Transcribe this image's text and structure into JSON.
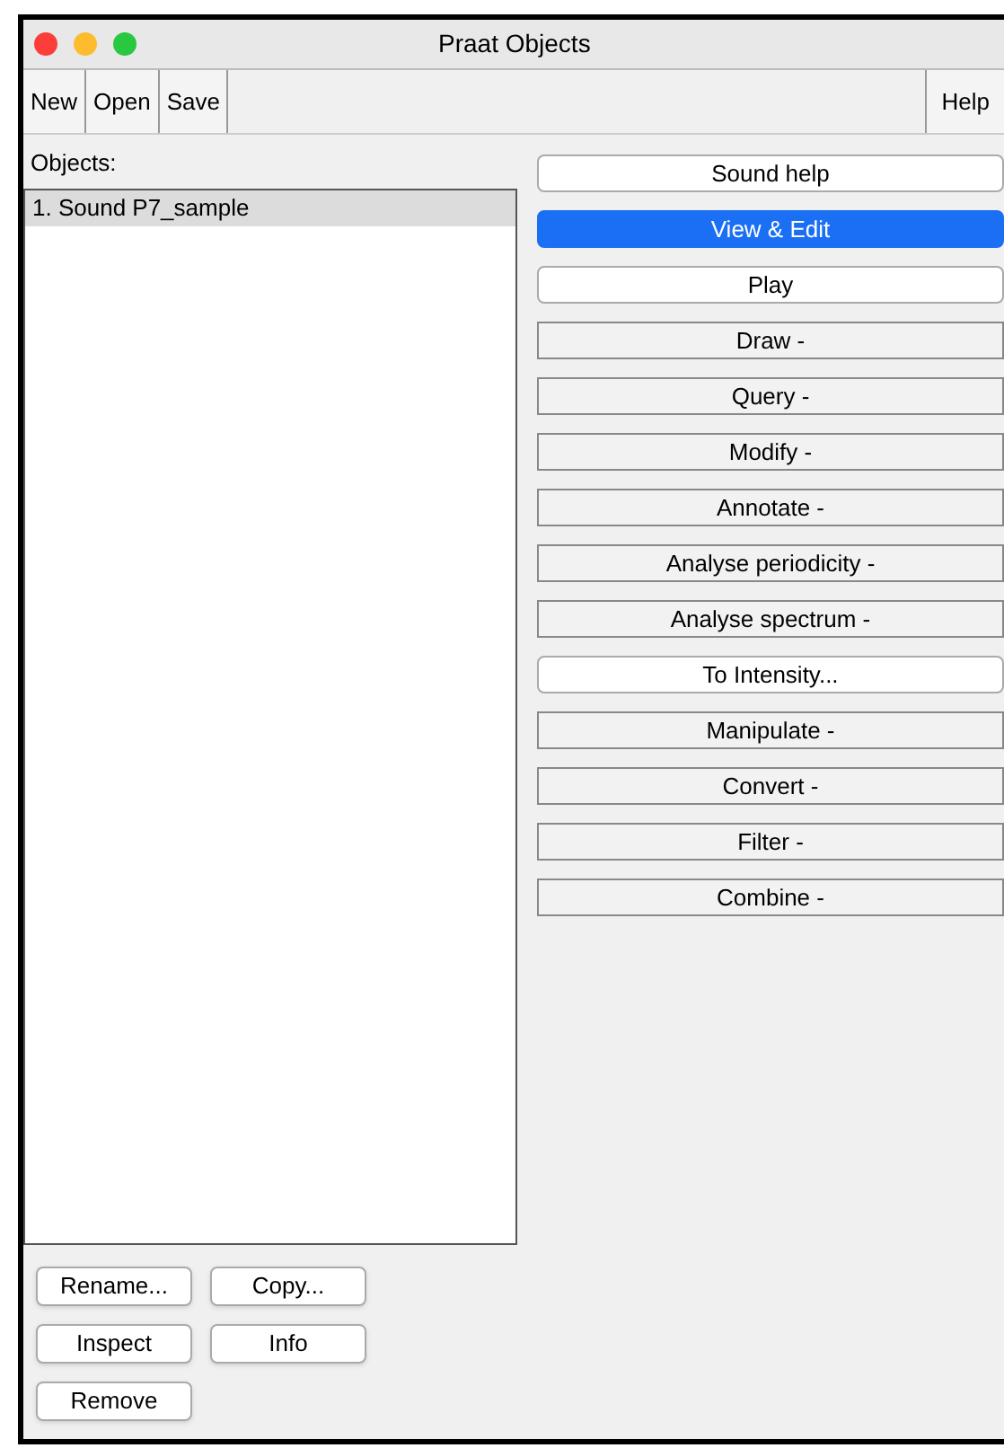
{
  "window": {
    "title": "Praat Objects"
  },
  "menu_bar": [
    {
      "label": "New"
    },
    {
      "label": "Open"
    },
    {
      "label": "Save"
    }
  ],
  "help_menu": {
    "label": "Help"
  },
  "objects": {
    "label": "Objects:",
    "items": [
      {
        "label": "1. Sound P7_sample",
        "selected": true
      }
    ]
  },
  "actions": [
    {
      "label": "Sound help",
      "kind": "push",
      "selected": false
    },
    {
      "label": "View & Edit",
      "kind": "push",
      "selected": true
    },
    {
      "label": "Play",
      "kind": "push",
      "selected": false
    },
    {
      "label": "Draw -",
      "kind": "menu",
      "selected": false
    },
    {
      "label": "Query -",
      "kind": "menu",
      "selected": false
    },
    {
      "label": "Modify -",
      "kind": "menu",
      "selected": false
    },
    {
      "label": "Annotate -",
      "kind": "menu",
      "selected": false
    },
    {
      "label": "Analyse periodicity -",
      "kind": "menu",
      "selected": false
    },
    {
      "label": "Analyse spectrum -",
      "kind": "menu",
      "selected": false
    },
    {
      "label": "To Intensity...",
      "kind": "push",
      "selected": false
    },
    {
      "label": "Manipulate -",
      "kind": "menu",
      "selected": false
    },
    {
      "label": "Convert -",
      "kind": "menu",
      "selected": false
    },
    {
      "label": "Filter -",
      "kind": "menu",
      "selected": false
    },
    {
      "label": "Combine -",
      "kind": "menu",
      "selected": false
    }
  ],
  "bottom_buttons": [
    [
      {
        "label": "Rename..."
      },
      {
        "label": "Copy..."
      }
    ],
    [
      {
        "label": "Inspect"
      },
      {
        "label": "Info"
      }
    ],
    [
      {
        "label": "Remove"
      }
    ]
  ]
}
